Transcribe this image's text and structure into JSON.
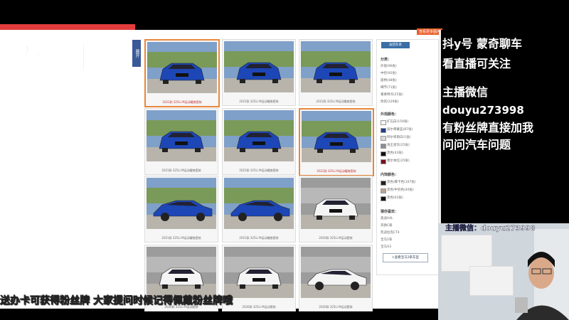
{
  "overlay": {
    "recording_label": "录像中",
    "expand_label": "展开",
    "top_link": "查看更多图片"
  },
  "gallery": {
    "items": [
      {
        "caption": "2021款 325Li M运动曜夜套装",
        "color": "blue",
        "view": "front34",
        "selected": true
      },
      {
        "caption": "2021款 325Li M运动曜夜套装",
        "color": "blue",
        "view": "front",
        "selected": false
      },
      {
        "caption": "2021款 325Li M运动曜夜套装",
        "color": "blue",
        "view": "front34r",
        "selected": false
      },
      {
        "caption": "2021款 325Li M运动曜夜套装",
        "color": "blue",
        "view": "rear34",
        "selected": false
      },
      {
        "caption": "2021款 325Li M运动曜夜套装",
        "color": "blue",
        "view": "rear",
        "selected": false
      },
      {
        "caption": "2021款 325Li M运动曜夜套装",
        "color": "blue",
        "view": "rear34r",
        "selected": true
      },
      {
        "caption": "2021款 325Li M运动曜夜套装",
        "color": "blue",
        "view": "side",
        "selected": false
      },
      {
        "caption": "2021款 325Li M运动曜夜套装",
        "color": "blue",
        "view": "side34",
        "selected": false
      },
      {
        "caption": "2020款 325Li M运动套装",
        "color": "white",
        "view": "front34",
        "selected": false
      },
      {
        "caption": "2020款 325Li M运动套装",
        "color": "white",
        "view": "front",
        "selected": false
      },
      {
        "caption": "2020款 325Li M运动套装",
        "color": "white",
        "view": "front34r",
        "selected": false
      },
      {
        "caption": "2020款 325Li M运动套装",
        "color": "white",
        "view": "side",
        "selected": false
      }
    ]
  },
  "sidebar": {
    "back_button": "返回车系",
    "category_title": "分类：",
    "categories": [
      "外观(96张)",
      "中控(92张)",
      "座椅(48张)",
      "细节(71张)",
      "重要特点(25张)",
      "改装(229张)"
    ],
    "exterior_title": "外观颜色：",
    "exterior_colors": [
      {
        "name": "矿石白(159张)",
        "hex": "#f4f4f4"
      },
      {
        "name": "波尔蒂蒙蓝(87张)",
        "hex": "#1d3f8c"
      },
      {
        "name": "阿尔卑斯白(1张)",
        "hex": "#dadada"
      },
      {
        "name": "海王星灰(25张)",
        "hex": "#8a8f96"
      },
      {
        "name": "黑色(43张)",
        "hex": "#111111"
      },
      {
        "name": "墨尔本红(25张)",
        "hex": "#7a1020"
      }
    ],
    "interior_title": "内饰颜色：",
    "interior_colors": [
      {
        "name": "黑色/摩卡色(107张)",
        "hex": "#2a1f1a"
      },
      {
        "name": "黑色/牛奶色(40张)",
        "hex": "#b9a48a"
      },
      {
        "name": "黑色(63张)",
        "hex": "#111111"
      }
    ],
    "recommend_title": "猜你喜欢：",
    "recommend": [
      "奥迪A4L",
      "奔驰C级",
      "凯迪拉克CT4",
      "宝马5系",
      "宝马X3"
    ],
    "view_button": ">查看宝马3系车型"
  },
  "stream": {
    "lines": [
      "抖y号  蒙奇聊车",
      "看直播可关注",
      "主播微信",
      "douyu273998",
      "有粉丝牌直接加我",
      "问问汽车问题"
    ],
    "cam_watermark": "主播微信：douyu273998",
    "bottom_banner": "送办卡可获得粉丝牌  大家提问时候记得佩戴粉丝牌哦"
  },
  "colors": {
    "accent": "#e8883c",
    "link": "#3b6ea5",
    "rec": "#1e86ff"
  }
}
